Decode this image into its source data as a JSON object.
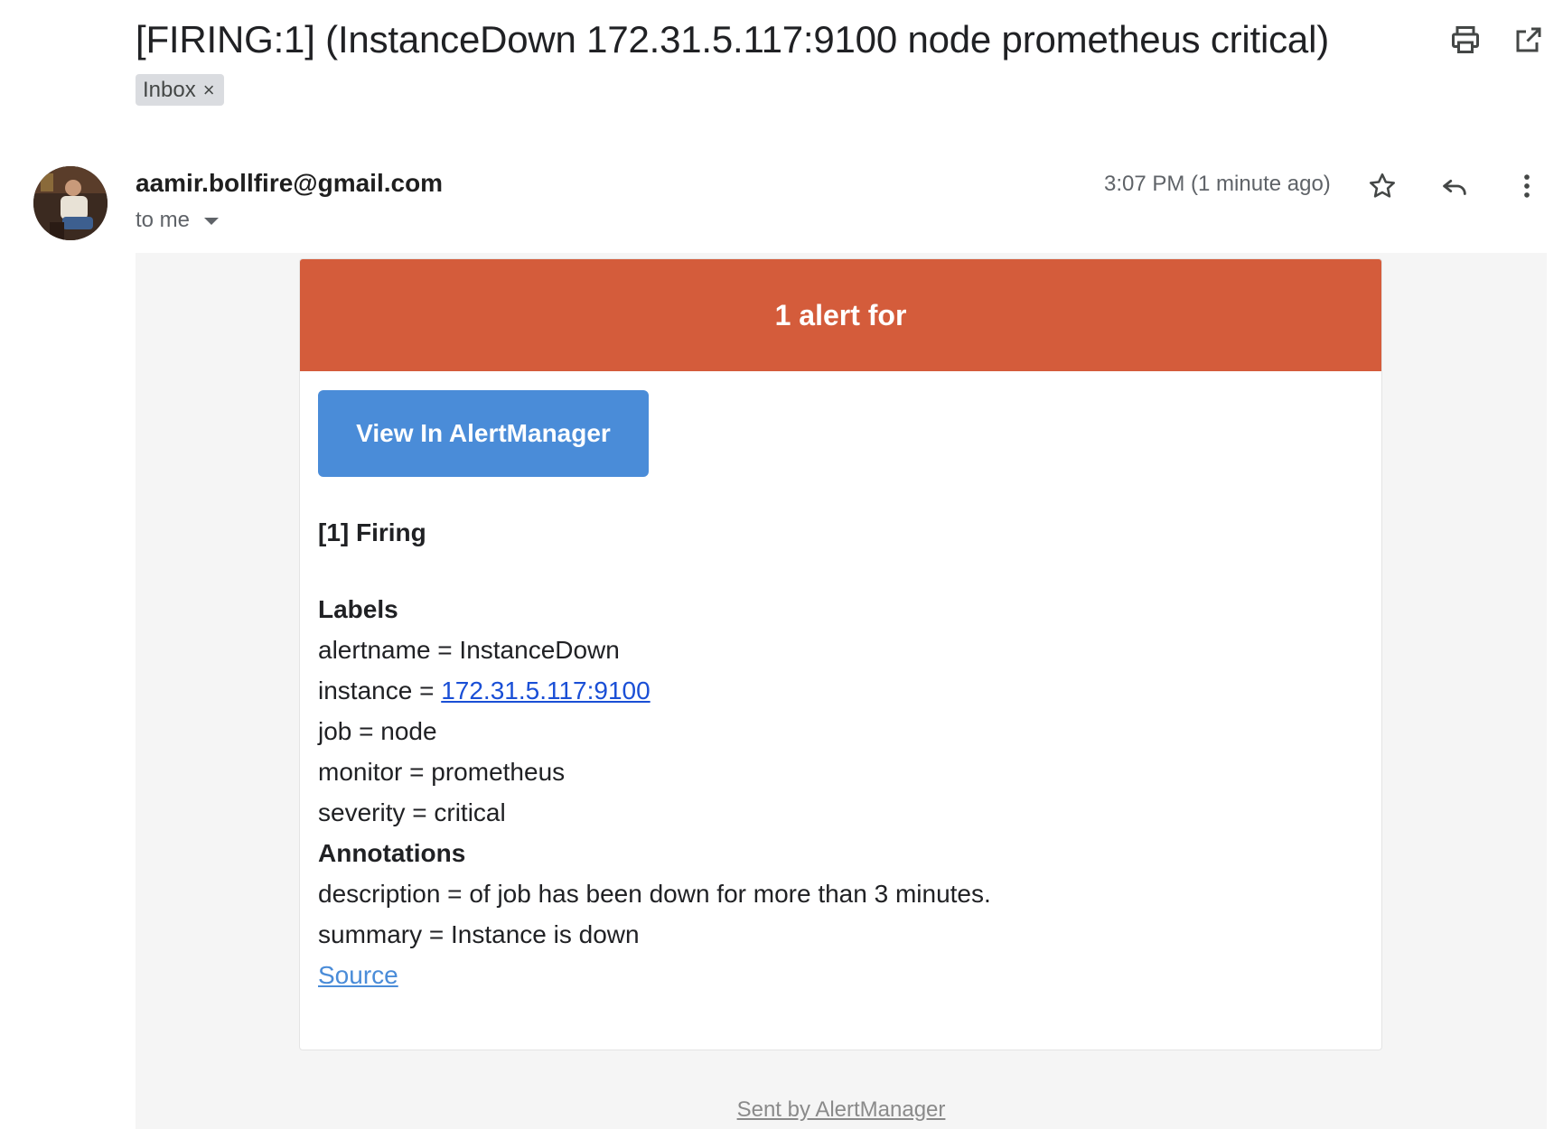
{
  "header": {
    "subject": "[FIRING:1] (InstanceDown 172.31.5.117:9100 node prometheus critical)",
    "label": "Inbox",
    "icons": [
      "print-icon",
      "open-in-new-window-icon"
    ]
  },
  "message": {
    "sender": "aamir.bollfire@gmail.com",
    "recipient": "to me",
    "timestamp": "3:07 PM (1 minute ago)",
    "icons": [
      "star-icon",
      "reply-icon",
      "more-vert-icon"
    ]
  },
  "email": {
    "banner": "1 alert for",
    "button": "View In AlertManager",
    "firing_heading": "[1] Firing",
    "labels_heading": "Labels",
    "labels": {
      "alertname": "alertname = InstanceDown",
      "instance_key": "instance = ",
      "instance_value": "172.31.5.117:9100",
      "job": "job = node",
      "monitor": "monitor = prometheus",
      "severity": "severity = critical"
    },
    "annotations_heading": "Annotations",
    "annotations": {
      "description": "description = of job has been down for more than 3 minutes.",
      "summary": "summary = Instance is down"
    },
    "source_link": "Source",
    "footer": "Sent by AlertManager"
  },
  "colors": {
    "banner": "#d45c3b",
    "button": "#4a8cd8",
    "link": "#1a4fd6"
  }
}
